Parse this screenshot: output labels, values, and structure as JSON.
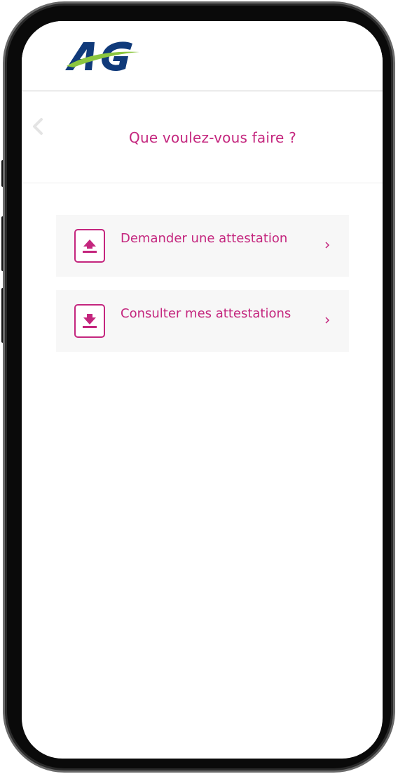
{
  "app": {
    "logo_text": "AG",
    "brand_colors": {
      "accent": "#c4267e",
      "logo_blue": "#103a7a",
      "logo_green": "#8cc63f"
    }
  },
  "header": {
    "title": "Que voulez-vous faire ?",
    "back_icon": "chevron-left-icon"
  },
  "menu": {
    "items": [
      {
        "label": "Demander une attestation",
        "icon": "upload-icon",
        "chevron": "chevron-right-icon"
      },
      {
        "label": "Consulter mes attestations",
        "icon": "download-icon",
        "chevron": "chevron-right-icon"
      }
    ]
  }
}
